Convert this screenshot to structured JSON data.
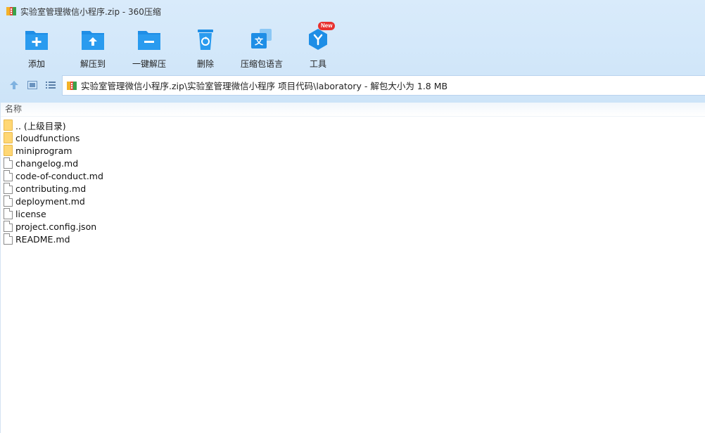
{
  "window": {
    "title": "实验室管理微信小程序.zip - 360压缩"
  },
  "toolbar": {
    "items": [
      {
        "label": "添加",
        "icon": "add-icon"
      },
      {
        "label": "解压到",
        "icon": "extract-to-icon"
      },
      {
        "label": "一键解压",
        "icon": "one-click-extract-icon"
      },
      {
        "label": "删除",
        "icon": "delete-icon"
      },
      {
        "label": "压缩包语言",
        "icon": "language-icon"
      },
      {
        "label": "工具",
        "icon": "tools-icon",
        "badge": "New"
      }
    ]
  },
  "address": {
    "path": "实验室管理微信小程序.zip\\实验室管理微信小程序 项目代码\\laboratory - 解包大小为 1.8 MB"
  },
  "list": {
    "column_name": "名称",
    "items": [
      {
        "name": ".. (上级目录)",
        "type": "folder"
      },
      {
        "name": "cloudfunctions",
        "type": "folder"
      },
      {
        "name": "miniprogram",
        "type": "folder"
      },
      {
        "name": "changelog.md",
        "type": "file"
      },
      {
        "name": "code-of-conduct.md",
        "type": "file"
      },
      {
        "name": "contributing.md",
        "type": "file"
      },
      {
        "name": "deployment.md",
        "type": "file"
      },
      {
        "name": "license",
        "type": "file"
      },
      {
        "name": "project.config.json",
        "type": "file"
      },
      {
        "name": "README.md",
        "type": "file"
      }
    ]
  },
  "colors": {
    "accent": "#1e8ee6",
    "badge": "#e8312f",
    "folder": "#ffd774"
  }
}
